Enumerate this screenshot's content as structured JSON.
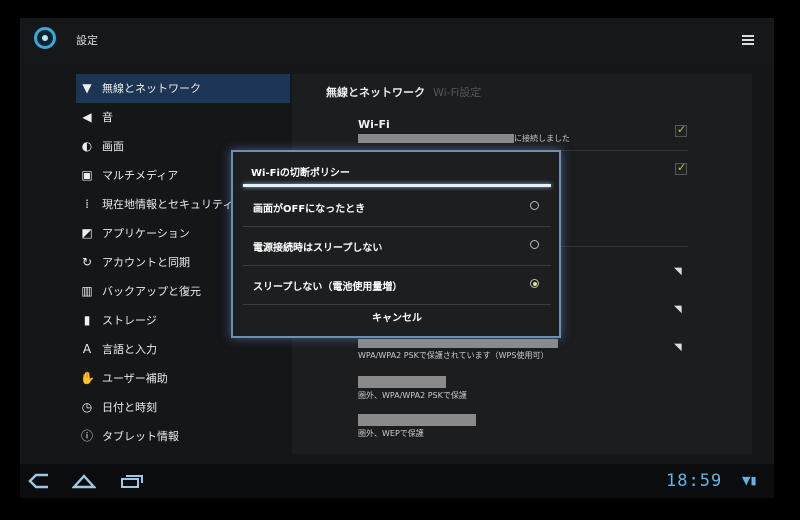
{
  "actionbar": {
    "title": "設定",
    "app_icon": "settings-app-icon",
    "menu_icon": "overflow-menu-icon"
  },
  "sidebar": {
    "items": [
      {
        "label": "無線とネットワーク",
        "icon": "▼",
        "active": true
      },
      {
        "label": "音",
        "icon": "◀"
      },
      {
        "label": "画面",
        "icon": "◐"
      },
      {
        "label": "マルチメディア",
        "icon": "▣"
      },
      {
        "label": "現在地情報とセキュリティ",
        "icon": "⁞"
      },
      {
        "label": "アプリケーション",
        "icon": "◩"
      },
      {
        "label": "アカウントと同期",
        "icon": "↻"
      },
      {
        "label": "バックアップと復元",
        "icon": "▥"
      },
      {
        "label": "ストレージ",
        "icon": "▮"
      },
      {
        "label": "言語と入力",
        "icon": "A"
      },
      {
        "label": "ユーザー補助",
        "icon": "✋"
      },
      {
        "label": "日付と時刻",
        "icon": "◷"
      },
      {
        "label": "タブレット情報",
        "icon": "ⓘ"
      }
    ]
  },
  "main": {
    "header": "無線とネットワーク",
    "subheader": "Wi-Fi設定",
    "wifi_title": "Wi-Fi",
    "wifi_status_suffix": "に接続しました",
    "networks": [
      {
        "security": "WPA/WPA2 PSKで保護されています（WPS使用可）"
      },
      {
        "security": "圏外、WPA/WPA2 PSKで保護"
      },
      {
        "security": "圏外、WEPで保護"
      }
    ]
  },
  "dialog": {
    "title": "Wi-Fiの切断ポリシー",
    "options": [
      {
        "label": "画面がOFFになったとき",
        "selected": false
      },
      {
        "label": "電源接続時はスリープしない",
        "selected": false
      },
      {
        "label": "スリープしない（電池使用量増）",
        "selected": true
      }
    ],
    "cancel": "キャンセル"
  },
  "statusbar": {
    "time": "18:59"
  },
  "colors": {
    "accent": "#5fb6e6",
    "active_bg": "#1d3554",
    "check": "#9ad64a"
  }
}
